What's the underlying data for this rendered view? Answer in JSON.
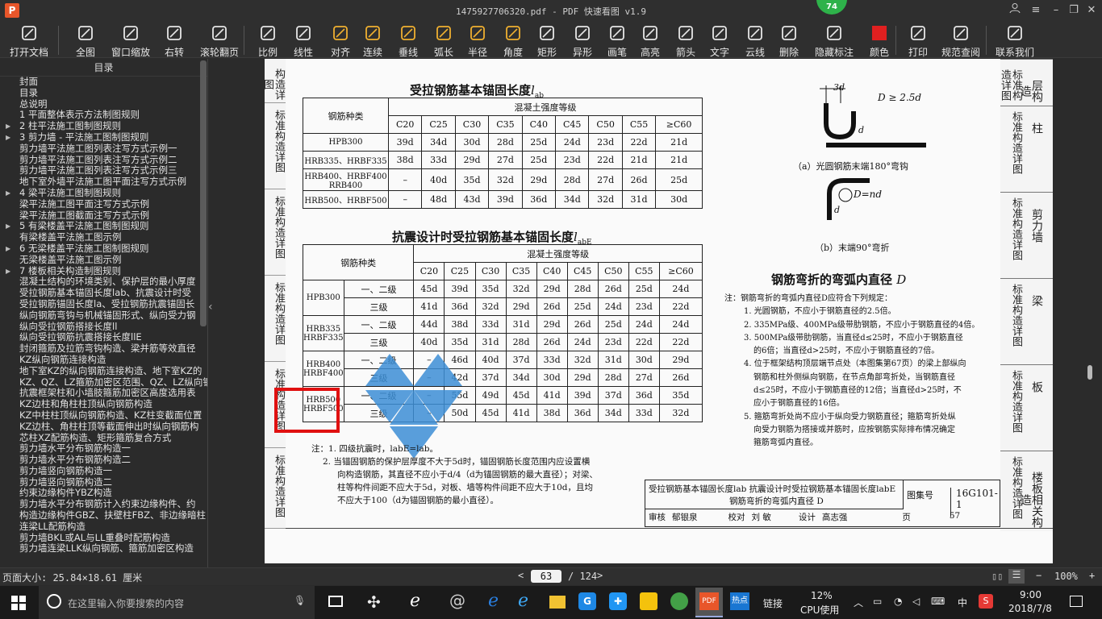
{
  "window": {
    "title": "1475927706320.pdf - PDF 快速看图 v1.9",
    "badge": "74",
    "app_logo": "P"
  },
  "toolbar": [
    {
      "label": "打开文档",
      "icon": "folder-icon"
    },
    {
      "label": "全图",
      "icon": "fullview-icon"
    },
    {
      "label": "窗口缩放",
      "icon": "zoom-window-icon"
    },
    {
      "label": "右转",
      "icon": "rotate-right-icon"
    },
    {
      "label": "滚轮翻页",
      "icon": "mouse-wheel-icon"
    },
    {
      "label": "比例",
      "icon": "scale-icon"
    },
    {
      "label": "线性",
      "icon": "linear-measure-icon"
    },
    {
      "label": "对齐",
      "icon": "align-measure-icon"
    },
    {
      "label": "连续",
      "icon": "continuous-measure-icon"
    },
    {
      "label": "垂线",
      "icon": "perpendicular-icon"
    },
    {
      "label": "弧长",
      "icon": "arc-length-icon"
    },
    {
      "label": "半径",
      "icon": "radius-icon"
    },
    {
      "label": "角度",
      "icon": "angle-icon"
    },
    {
      "label": "矩形",
      "icon": "rectangle-area-icon"
    },
    {
      "label": "异形",
      "icon": "polygon-area-icon"
    },
    {
      "label": "画笔",
      "icon": "pen-icon"
    },
    {
      "label": "高亮",
      "icon": "highlighter-icon"
    },
    {
      "label": "箭头",
      "icon": "arrow-icon"
    },
    {
      "label": "文字",
      "icon": "text-icon"
    },
    {
      "label": "云线",
      "icon": "cloud-line-icon"
    },
    {
      "label": "删除",
      "icon": "eraser-icon"
    },
    {
      "label": "隐藏标注",
      "icon": "hide-annotation-icon"
    },
    {
      "label": "颜色",
      "icon": "color-icon",
      "color": "#e02020"
    },
    {
      "label": "打印",
      "icon": "printer-icon"
    },
    {
      "label": "规范查阅",
      "icon": "spec-book-icon"
    },
    {
      "label": "联系我们",
      "icon": "contact-icon"
    }
  ],
  "sidebar": {
    "header": "目录",
    "items": [
      {
        "label": "封面",
        "arrow": false
      },
      {
        "label": "目录",
        "arrow": false
      },
      {
        "label": "总说明",
        "arrow": false
      },
      {
        "label": "1 平面整体表示方法制图规则",
        "arrow": false
      },
      {
        "label": "2 柱平法施工图制图规则",
        "arrow": true
      },
      {
        "label": "3 剪力墙 - 平法施工图制图规则",
        "arrow": true
      },
      {
        "label": "剪力墙平法施工图列表注写方式示例一",
        "arrow": false
      },
      {
        "label": "剪力墙平法施工图列表注写方式示例二",
        "arrow": false
      },
      {
        "label": "剪力墙平法施工图列表注写方式示例三",
        "arrow": false
      },
      {
        "label": "地下室外墙平法施工图平面注写方式示例",
        "arrow": false
      },
      {
        "label": "4 梁平法施工图制图规则",
        "arrow": true
      },
      {
        "label": "梁平法施工图平面注写方式示例",
        "arrow": false
      },
      {
        "label": "梁平法施工图截面注写方式示例",
        "arrow": false
      },
      {
        "label": "5 有梁楼盖平法施工图制图规则",
        "arrow": true
      },
      {
        "label": "有梁楼盖平法施工图示例",
        "arrow": false
      },
      {
        "label": "6 无梁楼盖平法施工图制图规则",
        "arrow": true
      },
      {
        "label": "无梁楼盖平法施工图示例",
        "arrow": false
      },
      {
        "label": "7 楼板相关构造制图规则",
        "arrow": true
      },
      {
        "label": "混凝土结构的环境类别、保护层的最小厚度",
        "arrow": false
      },
      {
        "label": "受拉钢筋基本锚固长度lab、抗震设计时受",
        "arrow": false
      },
      {
        "label": "受拉钢筋锚固长度la、受拉钢筋抗震锚固长",
        "arrow": false
      },
      {
        "label": "纵向钢筋弯钩与机械锚固形式、纵向受力钢",
        "arrow": false
      },
      {
        "label": "纵向受拉钢筋搭接长度ll",
        "arrow": false
      },
      {
        "label": "纵向受拉钢筋抗震搭接长度llE",
        "arrow": false
      },
      {
        "label": "封闭箍筋及拉筋弯钩构造、梁并筋等效直径",
        "arrow": false
      },
      {
        "label": "KZ纵向钢筋连接构造",
        "arrow": false
      },
      {
        "label": "地下室KZ的纵向钢筋连接构造、地下室KZ的",
        "arrow": false
      },
      {
        "label": "KZ、QZ、LZ箍筋加密区范围、QZ、LZ纵向钢筋",
        "arrow": false
      },
      {
        "label": "抗震框架柱和小墙肢箍筋加密区高度选用表",
        "arrow": false
      },
      {
        "label": "KZ边柱和角柱柱顶纵向钢筋构造",
        "arrow": false
      },
      {
        "label": "KZ中柱柱顶纵向钢筋构造、KZ柱变截面位置",
        "arrow": false
      },
      {
        "label": "KZ边柱、角柱柱顶等截面伸出时纵向钢筋构",
        "arrow": false
      },
      {
        "label": "芯柱XZ配筋构造、矩形箍筋复合方式",
        "arrow": false
      },
      {
        "label": "剪力墙水平分布钢筋构造一",
        "arrow": false
      },
      {
        "label": "剪力墙水平分布钢筋构造二",
        "arrow": false
      },
      {
        "label": "剪力墙竖向钢筋构造一",
        "arrow": false
      },
      {
        "label": "剪力墙竖向钢筋构造二",
        "arrow": false
      },
      {
        "label": "约束边缘构件YBZ构造",
        "arrow": false
      },
      {
        "label": "剪力墙水平分布钢筋计入约束边缘构件、约",
        "arrow": false
      },
      {
        "label": "构造边缘构件GBZ、扶壁柱FBZ、非边缘暗柱",
        "arrow": false
      },
      {
        "label": "连梁LL配筋构造",
        "arrow": false
      },
      {
        "label": "剪力墙BKL或AL与LL重叠时配筋构造",
        "arrow": false
      },
      {
        "label": "剪力墙连梁LLK纵向钢筋、箍筋加密区构造",
        "arrow": false
      }
    ]
  },
  "doc": {
    "left_tabs": [
      "构造详图",
      "标准构造详图",
      "标准构造详图",
      "标准构造详图",
      "标准构造详图",
      "标准构造详图"
    ],
    "right_tabs": [
      {
        "v": "标准构造详图",
        "h": "层构造"
      },
      {
        "v": "标准构造详图",
        "h": "柱"
      },
      {
        "v": "标准构造详图",
        "h": "剪力墙"
      },
      {
        "v": "标准构造详图",
        "h": "梁"
      },
      {
        "v": "标准构造详图",
        "h": "板"
      },
      {
        "v": "标准构造详图",
        "h": "楼板相关构造"
      }
    ],
    "table1": {
      "title": "受拉钢筋基本锚固长度",
      "title_sym": "l",
      "title_sub": "ab",
      "col0": "钢筋种类",
      "group": "混凝土强度等级",
      "grades": [
        "C20",
        "C25",
        "C30",
        "C35",
        "C40",
        "C45",
        "C50",
        "C55",
        "≥C60"
      ],
      "rows": [
        {
          "name": "HPB300",
          "vals": [
            "39d",
            "34d",
            "30d",
            "28d",
            "25d",
            "24d",
            "23d",
            "22d",
            "21d"
          ]
        },
        {
          "name": "HRB335、HRBF335",
          "vals": [
            "38d",
            "33d",
            "29d",
            "27d",
            "25d",
            "23d",
            "22d",
            "21d",
            "21d"
          ]
        },
        {
          "name": "HRB400、HRBF400 RRB400",
          "vals": [
            "–",
            "40d",
            "35d",
            "32d",
            "29d",
            "28d",
            "27d",
            "26d",
            "25d"
          ]
        },
        {
          "name": "HRB500、HRBF500",
          "vals": [
            "–",
            "48d",
            "43d",
            "39d",
            "36d",
            "34d",
            "32d",
            "31d",
            "30d"
          ]
        }
      ]
    },
    "table2": {
      "title": "抗震设计时受拉钢筋基本锚固长度",
      "title_sym": "l",
      "title_sub": "abE",
      "col0": "钢筋种类",
      "group": "混凝土强度等级",
      "grades": [
        "C20",
        "C25",
        "C30",
        "C35",
        "C40",
        "C45",
        "C50",
        "C55",
        "≥C60"
      ],
      "rows": [
        {
          "name": "HPB300",
          "level": "一、二级",
          "vals": [
            "45d",
            "39d",
            "35d",
            "32d",
            "29d",
            "28d",
            "26d",
            "25d",
            "24d"
          ]
        },
        {
          "name": "",
          "level": "三级",
          "vals": [
            "41d",
            "36d",
            "32d",
            "29d",
            "26d",
            "25d",
            "24d",
            "23d",
            "22d"
          ]
        },
        {
          "name": "HRB335 HRBF335",
          "level": "一、二级",
          "vals": [
            "44d",
            "38d",
            "33d",
            "31d",
            "29d",
            "26d",
            "25d",
            "24d",
            "24d"
          ]
        },
        {
          "name": "",
          "level": "三级",
          "vals": [
            "40d",
            "35d",
            "31d",
            "28d",
            "26d",
            "24d",
            "23d",
            "22d",
            "22d"
          ]
        },
        {
          "name": "HRB400 HRBF400",
          "level": "一、二级",
          "vals": [
            "–",
            "46d",
            "40d",
            "37d",
            "33d",
            "32d",
            "31d",
            "30d",
            "29d"
          ]
        },
        {
          "name": "",
          "level": "三级",
          "vals": [
            "–",
            "42d",
            "37d",
            "34d",
            "30d",
            "29d",
            "28d",
            "27d",
            "26d"
          ]
        },
        {
          "name": "HRB500 HRBF500",
          "level": "一、二级",
          "vals": [
            "–",
            "55d",
            "49d",
            "45d",
            "41d",
            "39d",
            "37d",
            "36d",
            "35d"
          ]
        },
        {
          "name": "",
          "level": "三级",
          "vals": [
            "–",
            "50d",
            "45d",
            "41d",
            "38d",
            "36d",
            "34d",
            "33d",
            "32d"
          ]
        }
      ]
    },
    "notes_left": [
      "注：1. 四级抗震时，labE=lab。",
      "2. 当锚固钢筋的保护层厚度不大于5d时，锚固钢筋长度范围内应设置横",
      "向构造钢筋，其直径不应小于d/4（d为锚固钢筋的最大直径）；对梁、",
      "柱等构件间距不应大于5d，对板、墙等构件间距不应大于10d，且均",
      "不应大于100（d为锚固钢筋的最小直径）。"
    ],
    "fig_a_caption": "（a）光圆钢筋末端180°弯钩",
    "fig_a_dim1": "3d",
    "fig_a_dim2": "D ≥ 2.5d",
    "fig_a_dim3": "d",
    "fig_b_caption": "（b）末端90°弯折",
    "fig_b_dim1": "D=nd",
    "fig_b_dim2": "d",
    "bend_title": "钢筋弯折的弯弧内直径",
    "bend_title_sym": "D",
    "bend_notes": [
      "注：钢筋弯折的弯弧内直径D应符合下列规定：",
      "1. 光圆钢筋，不应小于钢筋直径的2.5倍。",
      "2. 335MPa级、400MPa级带肋钢筋，不应小于钢筋直径的4倍。",
      "3. 500MPa级带肋钢筋，当直径d≤25时，不应小于钢筋直径",
      "的6倍；当直径d>25时，不应小于钢筋直径的7倍。",
      "4. 位于框架结构顶层端节点处（本图集第67页）的梁上部纵向",
      "钢筋和柱外侧纵向钢筋，在节点角部弯折处，当钢筋直径",
      "d≤25时，不应小于钢筋直径的12倍；当直径d>25时，不",
      "应小于钢筋直径的16倍。",
      "5. 箍筋弯折处尚不应小于纵向受力钢筋直径；箍筋弯折处纵",
      "向受力钢筋为搭接或并筋时，应按钢筋实际排布情况确定",
      "箍筋弯弧内直径。"
    ],
    "titleblock": {
      "line1": "受拉钢筋基本锚固长度lab  抗震设计时受拉钢筋基本锚固长度labE",
      "line2": "钢筋弯折的弯弧内直径 D",
      "atlas_label": "图集号",
      "atlas_no": "16G101-1",
      "review_label": "审核",
      "review_name": "郁银泉",
      "check_label": "校对",
      "check_name": "刘 敏",
      "design_label": "设计",
      "design_name": "高志强",
      "page_label": "页",
      "page_no": "57"
    }
  },
  "status": {
    "page_size": "页面大小: 25.84×18.61 厘米",
    "current_page": "63",
    "total_pages": "/ 124",
    "zoom": "100%",
    "prev": "<",
    "next": ">",
    "zoom_out": "−",
    "zoom_in": "+"
  },
  "taskbar": {
    "search_placeholder": "在这里输入你要搜索的内容",
    "link_label": "链接",
    "cpu_percent": "12%",
    "cpu_label": "CPU使用",
    "ime": "中",
    "time": "9:00",
    "date": "2018/7/8"
  },
  "colors": {
    "accent_red": "#e02020",
    "highlight_box": "#e01010",
    "watermark_blue": "#3d8fd6"
  }
}
